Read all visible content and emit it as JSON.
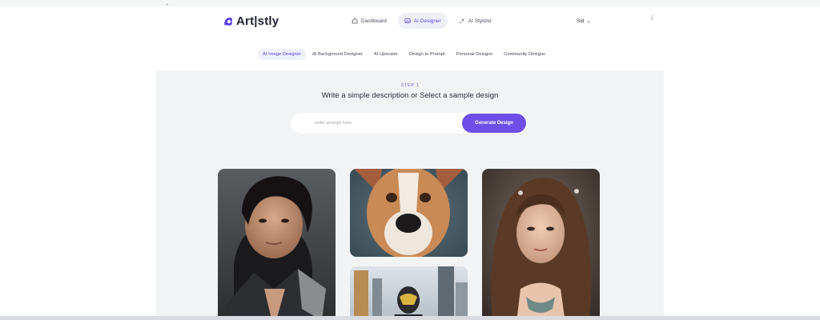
{
  "app": {
    "logo_text": "Art|stly",
    "brand_color": "#6d4ee8"
  },
  "nav": {
    "items": [
      {
        "label": "Dashboard",
        "icon": "home-icon",
        "active": false
      },
      {
        "label": "AI Designer",
        "icon": "image-icon",
        "active": true
      },
      {
        "label": "AI Stylizer",
        "icon": "sparkle-icon",
        "active": false
      }
    ],
    "user_label": "Sid",
    "theme_icon": "moon-icon"
  },
  "tabs": [
    {
      "label": "AI Image Designer",
      "active": true
    },
    {
      "label": "AI Background Designer",
      "active": false
    },
    {
      "label": "AI Upscaler",
      "active": false
    },
    {
      "label": "Design to Prompt",
      "active": false
    },
    {
      "label": "Personal Designs",
      "active": false
    },
    {
      "label": "Community Designs",
      "active": false
    }
  ],
  "main": {
    "step_label": "STEP 1",
    "step_title": "Write a simple description or Select a sample design",
    "prompt_placeholder": "enter prompt here",
    "prompt_value": "",
    "generate_label": "Generate Design"
  },
  "samples": [
    {
      "name": "man-portrait",
      "alt": "Dark haired man in leather armor"
    },
    {
      "name": "dog-portrait",
      "alt": "Close-up of a dog"
    },
    {
      "name": "robot-city",
      "alt": "Masked figure in a city"
    },
    {
      "name": "woman-portrait",
      "alt": "Woman with long wavy hair"
    }
  ]
}
